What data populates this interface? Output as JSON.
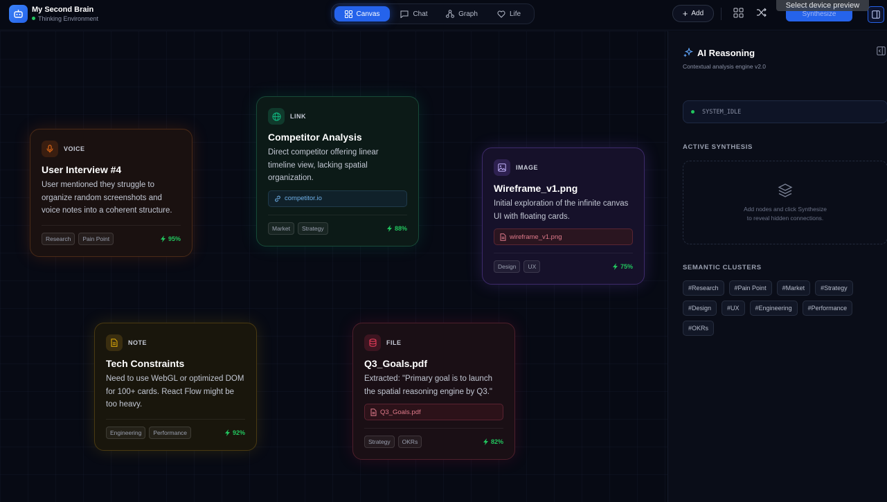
{
  "app": {
    "title": "My Second Brain",
    "subtitle": "Thinking Environment"
  },
  "tabs": [
    {
      "label": "Canvas",
      "icon": "grid-icon",
      "active": true
    },
    {
      "label": "Chat",
      "icon": "chat-icon",
      "active": false
    },
    {
      "label": "Graph",
      "icon": "graph-icon",
      "active": false
    },
    {
      "label": "Life",
      "icon": "heart-icon",
      "active": false
    }
  ],
  "toolbar": {
    "add_label": "Add",
    "synthesize_label": "Synthesize",
    "tooltip": "Select device preview"
  },
  "cards": {
    "voice": {
      "type": "VOICE",
      "title": "User Interview #4",
      "body": "User mentioned they struggle to organize random screenshots and voice notes into a coherent structure.",
      "tags": [
        "Research",
        "Pain Point"
      ],
      "score": "95%"
    },
    "link": {
      "type": "LINK",
      "title": "Competitor Analysis",
      "body": "Direct competitor offering linear timeline view, lacking spatial organization.",
      "attachment": "competitor.io",
      "tags": [
        "Market",
        "Strategy"
      ],
      "score": "88%"
    },
    "image": {
      "type": "IMAGE",
      "title": "Wireframe_v1.png",
      "body": "Initial exploration of the infinite canvas UI with floating cards.",
      "attachment": "wireframe_v1.png",
      "tags": [
        "Design",
        "UX"
      ],
      "score": "75%"
    },
    "note": {
      "type": "NOTE",
      "title": "Tech Constraints",
      "body": "Need to use WebGL or optimized DOM for 100+ cards. React Flow might be too heavy.",
      "tags": [
        "Engineering",
        "Performance"
      ],
      "score": "92%"
    },
    "file": {
      "type": "FILE",
      "title": "Q3_Goals.pdf",
      "body": "Extracted: \"Primary goal is to launch the spatial reasoning engine by Q3.\"",
      "attachment": "Q3_Goals.pdf",
      "tags": [
        "Strategy",
        "OKRs"
      ],
      "score": "82%"
    }
  },
  "panel": {
    "title": "AI Reasoning",
    "subtitle": "Contextual analysis engine v2.0",
    "status": "SYSTEM_IDLE",
    "active_synthesis_label": "ACTIVE SYNTHESIS",
    "synthesis_hint_line1": "Add nodes and click Synthesize",
    "synthesis_hint_line2": "to reveal hidden connections.",
    "clusters_label": "SEMANTIC CLUSTERS",
    "clusters": [
      "#Research",
      "#Pain Point",
      "#Market",
      "#Strategy",
      "#Design",
      "#UX",
      "#Engineering",
      "#Performance",
      "#OKRs"
    ]
  },
  "colors": {
    "accent": "#2563eb",
    "success": "#22c55e",
    "voice": "#f97316",
    "link": "#10b981",
    "image": "#a78bfa",
    "note": "#eab308",
    "file": "#f43f5e"
  }
}
